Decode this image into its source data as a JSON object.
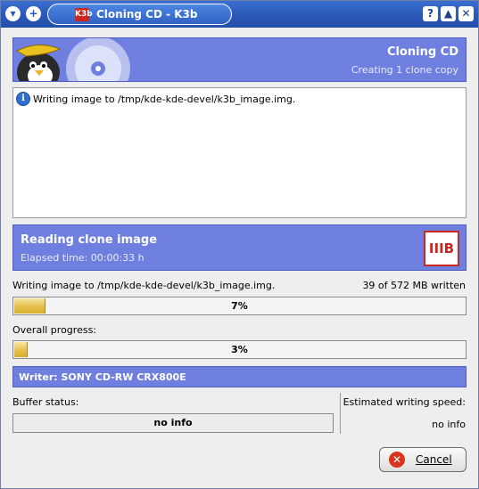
{
  "window": {
    "title": "Cloning CD - K3b",
    "logo": "K3b",
    "controls": [
      "?",
      "▲",
      "✕"
    ]
  },
  "header": {
    "title": "Cloning CD",
    "subtitle": "Creating 1 clone copy"
  },
  "log": {
    "icon": "info-icon",
    "lines": [
      "Writing image to /tmp/kde-kde-devel/k3b_image.img."
    ]
  },
  "status": {
    "title": "Reading clone image",
    "elapsed": "Elapsed time: 00:00:33 h",
    "logo": "IIIB"
  },
  "job": {
    "label": "Writing image to /tmp/kde-kde-devel/k3b_image.img.",
    "written": "39 of 572 MB written",
    "progress_label": "7%",
    "progress": 7
  },
  "overall": {
    "label": "Overall progress:",
    "progress_label": "3%",
    "progress": 3
  },
  "writer": {
    "label": "Writer: SONY CD-RW  CRX800E"
  },
  "buffer": {
    "label": "Buffer status:",
    "value": "no info"
  },
  "speed": {
    "label": "Estimated writing speed:",
    "value": "no info"
  },
  "cancel": {
    "label": "Cancel",
    "icon": "cancel-icon"
  }
}
